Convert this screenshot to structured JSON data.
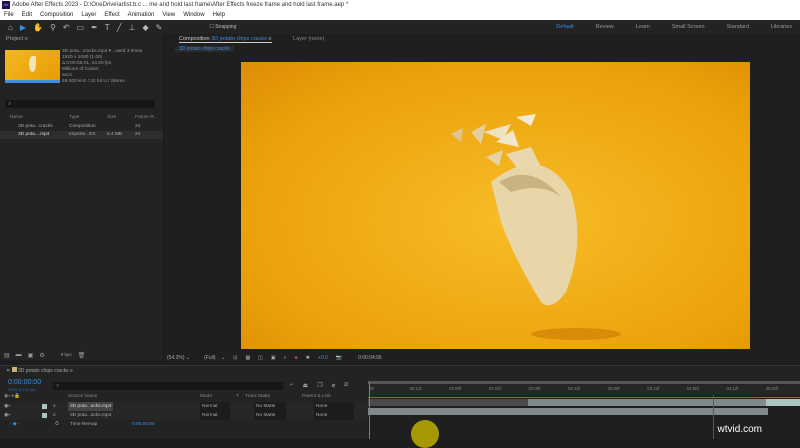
{
  "title": "Adobe After Effects 2023 - D:\\OneDrive\\artist.b.c ... me and hold last frame\\After Effects freeze frame and hold last frame.aep *",
  "logo": "Ae",
  "menu": [
    "File",
    "Edit",
    "Composition",
    "Layer",
    "Effect",
    "Animation",
    "View",
    "Window",
    "Help"
  ],
  "toolbar": {
    "snapping": "Snapping",
    "workspaces": [
      "Default",
      "Review",
      "Learn",
      "Small Screen",
      "Standard",
      "Libraries"
    ]
  },
  "project": {
    "title": "Project",
    "info": [
      "3D pota...cracks.mp4 ▾ , used 3 times",
      "1920 x 1080 (1.00)",
      "Δ 0:00:05:01, 24.00 fps",
      "Millions of Colors",
      "avc1",
      "48.000 kHz / 32 bit U / Stereo"
    ],
    "search_placeholder": "⌕",
    "columns": [
      "Name",
      "Type",
      "Size",
      "Frame R..."
    ],
    "rows": [
      {
        "name": "3D pota...cracks",
        "type": "Composition",
        "size": "",
        "fps": "24"
      },
      {
        "name": "3D pota....mp4",
        "type": "Importe...EX",
        "size": "5.4 MB",
        "fps": "24"
      }
    ],
    "bpc": "8 bpc"
  },
  "composition": {
    "tab_prefix": "Composition",
    "tab_name": "3D potato chips cracks",
    "layer_tab": "Layer  (none)",
    "subtab": "3D potato chips cracks",
    "zoom": "(54.3%)",
    "quality": "(Full)",
    "exposure": "+0.0",
    "timecode": "0:00:04:06"
  },
  "timeline": {
    "tab": "3D potato chips cracks",
    "current_time": "0:00:00:00",
    "fps_sub": "00000 (24.00 fps)",
    "columns": [
      "Source Name",
      "Mode",
      "T",
      "Track Matte",
      "Parent & Link"
    ],
    "layers": [
      {
        "num": "1",
        "name": "3D pota...acks.mp4",
        "mode": "Normal",
        "matte": "No Matte",
        "parent": "None"
      },
      {
        "num": "2",
        "name": "3D pota...acks.mp4",
        "mode": "Normal",
        "matte": "No Matte",
        "parent": "None"
      }
    ],
    "property": {
      "name": "Time Remap",
      "value": "0:00:00:00"
    },
    "ruler": [
      "0f",
      "00:12f",
      "01:00f",
      "01:12f",
      "02:00f",
      "02:12f",
      "03:00f",
      "03:12f",
      "04:00f",
      "04:12f",
      "05:00f"
    ]
  },
  "watermark": "wtvid.com"
}
